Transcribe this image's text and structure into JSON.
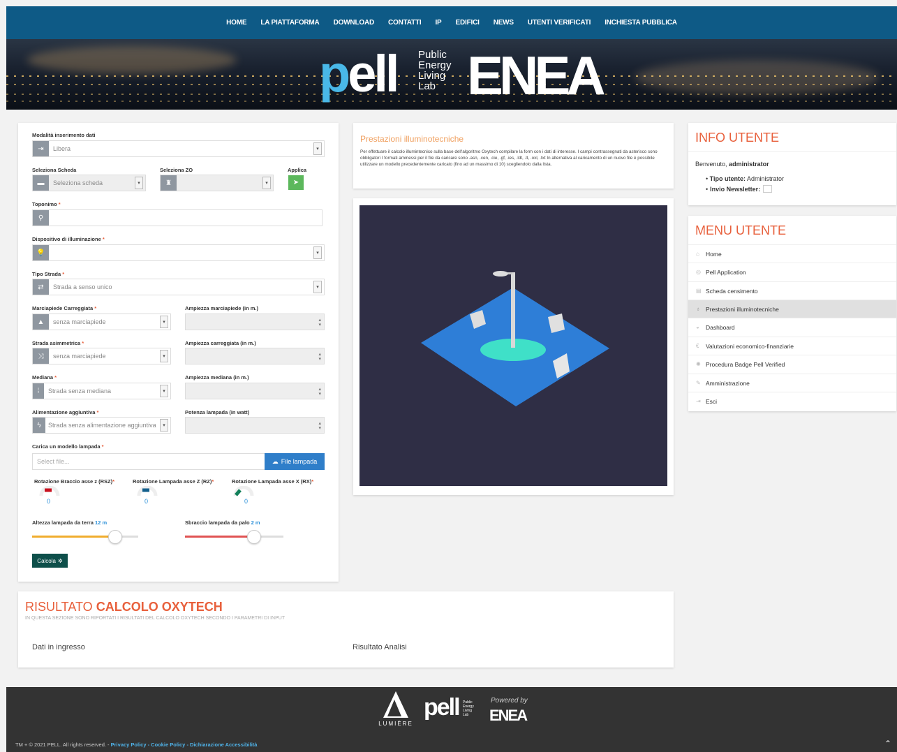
{
  "nav": [
    "HOME",
    "LA PIATTAFORMA",
    "DOWNLOAD",
    "CONTATTI",
    "IP",
    "EDIFICI",
    "NEWS",
    "UTENTI VERIFICATI",
    "INCHIESTA PUBBLICA"
  ],
  "banner": {
    "logo_pell": "pell",
    "logo_tagline": [
      "Public",
      "Energy",
      "Living",
      "Lab"
    ],
    "logo_enea": "ENEA"
  },
  "form": {
    "modalita_label": "Modalità inserimento dati",
    "modalita_value": "Libera",
    "scheda_label": "Seleziona Scheda",
    "scheda_value": "Seleziona scheda",
    "zo_label": "Seleziona ZO",
    "zo_value": "",
    "applica_label": "Applica",
    "toponimo_label": "Toponimo",
    "toponimo_value": "",
    "dispositivo_label": "Dispositivo di illuminazione",
    "dispositivo_value": "",
    "tipo_strada_label": "Tipo Strada",
    "tipo_strada_value": "Strada a senso unico",
    "marciapiede_label": "Marciapiede Carreggiata",
    "marciapiede_value": "senza marciapiede",
    "ampiezza_marciapiede_label": "Ampiezza marciapiede (in m.)",
    "asimmetrica_label": "Strada asimmetrica",
    "asimmetrica_value": "senza marciapiede",
    "ampiezza_carreggiata_label": "Ampiezza carreggiata (in m.)",
    "mediana_label": "Mediana",
    "mediana_value": "Strada senza mediana",
    "ampiezza_mediana_label": "Ampiezza mediana (in m.)",
    "alimentazione_label": "Alimentazione aggiuntiva",
    "alimentazione_value": "Strada senza alimentazione aggiuntiva",
    "potenza_label": "Potenza lampada (in watt)",
    "carica_label": "Carica un modello lampada",
    "carica_placeholder": "Select file...",
    "file_button": "File lampada",
    "rot1_label": "Rotazione Braccio asse z (RSZ)",
    "rot1_value": "0",
    "rot2_label": "Rotazione Lampada asse Z (RZ)",
    "rot2_value": "0",
    "rot3_label": "Rotazione Lampada asse X (RX)",
    "rot3_value": "0",
    "altezza_label": "Altezza lampada da terra",
    "altezza_value": "12 m",
    "altezza_fraction": 0.78,
    "sbraccio_label": "Sbraccio lampada da palo",
    "sbraccio_value": "2 m",
    "sbraccio_fraction": 0.7,
    "calcola_button": "Calcola"
  },
  "prestazioni": {
    "title": "Prestazioni illuminotecniche",
    "text": "Per effettuare il calcolo illumintecnico sulla base dell'algoritmo Oxytech compilare la form con i dati di interesse. I campi contrassegnati da asterisco sono obbligatori I formati ammessi per il file da caricare sono .asn, .cen, .cie, .gf, .ies, .ldt, .lt, .oxl, .txt In alternativa al caricamento di un nuovo file è possibile utilizzare un modello precedentemente caricato (fino ad un massimo di 10) scegliendolo dalla lista."
  },
  "info_utente": {
    "title": "INFO UTENTE",
    "welcome": "Benvenuto,",
    "username": "administrator",
    "tipo_label": "Tipo utente:",
    "tipo_value": "Administrator",
    "newsletter_label": "Invio Newsletter:"
  },
  "menu_utente": {
    "title": "MENU UTENTE",
    "items": [
      "Home",
      "Pell Application",
      "Scheda censimento",
      "Prestazioni illuminotecniche",
      "Dashboard",
      "Valutazioni economico-finanziarie",
      "Procedura Badge Pell Verified",
      "Amministrazione",
      "Esci"
    ],
    "active_index": 3
  },
  "risultato": {
    "title_light": "RISULTATO",
    "title_bold": "CALCOLO OXYTECH",
    "subtitle": "IN QUESTA SEZIONE SONO RIPORTATI I RISULTATI DEL CALCOLO OXYTECH SECONDO I PARAMETRI DI INPUT",
    "col1": "Dati in ingresso",
    "col2": "Risultato Analisi"
  },
  "footer": {
    "lumiere": "LUMIÈRE",
    "pell": "pell",
    "powered": "Powered by",
    "enea": "ENEA",
    "copyright": "TM + © 2021 PELL. All rights reserved. -",
    "links": "Privacy Policy - Cookie Policy - Dichiarazione Accessibilità"
  },
  "colors": {
    "nav": "#0e5a86",
    "accent": "#e8603c",
    "green": "#5cb85c",
    "blue_btn": "#2f7ec9",
    "calcola": "#0e4f4a",
    "scene_bg": "#2f2e45",
    "plane": "#2e7ed7"
  }
}
